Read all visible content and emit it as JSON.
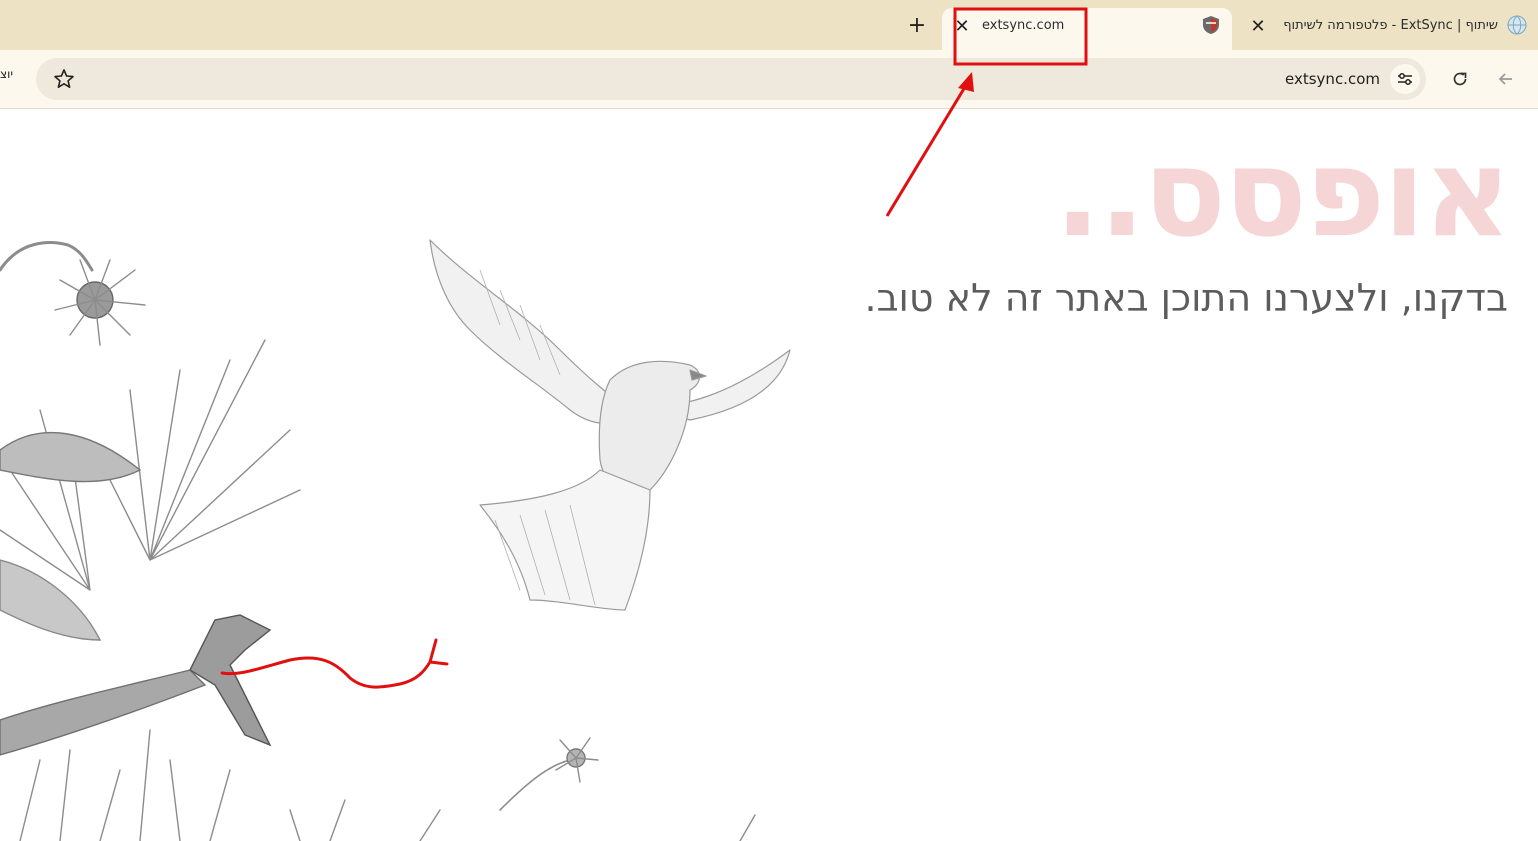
{
  "tabs": [
    {
      "title": "extsync.com",
      "close_icon": "close-icon",
      "favicon": "shield-favicon-icon",
      "active": true
    },
    {
      "title": "שיתוף | ExtSync - פלטפורמה לשיתוף",
      "close_icon": "close-icon",
      "favicon": "globe-favicon-icon",
      "active": false
    }
  ],
  "new_tab_symbol": "+",
  "close_symbol": "✕",
  "toolbar": {
    "url": "extsync.com",
    "bookmark_icon": "star-icon",
    "site_info_icon": "tune-icon",
    "reload_icon": "reload-icon",
    "back_icon": "back-arrow-icon",
    "extension_label": "יוצ"
  },
  "page": {
    "heading": "אופסס..",
    "message": "בדקנו, ולצערנו התוכן באתר זה לא טוב."
  },
  "colors": {
    "tab_strip": "#ede2c4",
    "active_tab": "#fcf8ee",
    "omnibox": "#efe8dc",
    "heading": "#f5d5d5",
    "message": "#5c5c5c",
    "annotation": "#e11010"
  }
}
